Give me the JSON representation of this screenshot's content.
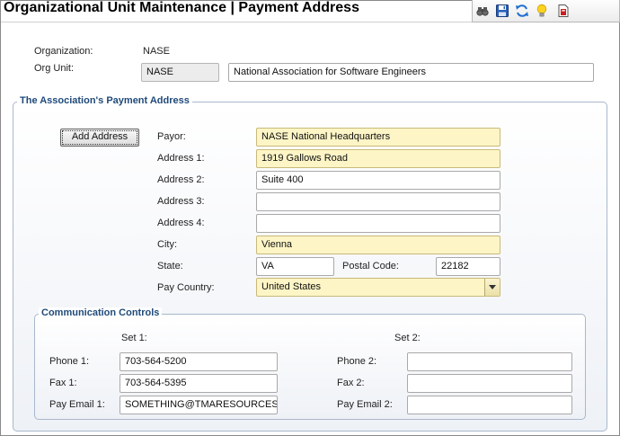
{
  "header": {
    "title": "Organizational Unit Maintenance | Payment Address",
    "toolbar_icons": [
      "binoculars-icon",
      "save-icon",
      "refresh-icon",
      "lightbulb-icon",
      "report-icon"
    ]
  },
  "org": {
    "organization_label": "Organization:",
    "organization_value": "NASE",
    "org_unit_label": "Org Unit:",
    "org_unit_code": "NASE",
    "org_unit_name": "National Association for Software Engineers"
  },
  "payment_address": {
    "legend": "The Association's Payment Address",
    "add_address_label": "Add Address",
    "payor_label": "Payor:",
    "payor_value": "NASE National Headquarters",
    "address1_label": "Address 1:",
    "address1_value": "1919 Gallows Road",
    "address2_label": "Address 2:",
    "address2_value": "Suite 400",
    "address3_label": "Address 3:",
    "address3_value": "",
    "address4_label": "Address 4:",
    "address4_value": "",
    "city_label": "City:",
    "city_value": "Vienna",
    "state_label": "State:",
    "state_value": "VA",
    "postal_label": "Postal Code:",
    "postal_value": "22182",
    "country_label": "Pay Country:",
    "country_value": "United States"
  },
  "communication": {
    "legend": "Communication Controls",
    "set1_label": "Set 1:",
    "set2_label": "Set 2:",
    "phone1_label": "Phone 1:",
    "phone1_value": "703-564-5200",
    "fax1_label": "Fax 1:",
    "fax1_value": "703-564-5395",
    "email1_label": "Pay Email 1:",
    "email1_value": "SOMETHING@TMARESOURCES.C",
    "phone2_label": "Phone 2:",
    "phone2_value": "",
    "fax2_label": "Fax 2:",
    "fax2_value": "",
    "email2_label": "Pay Email 2:",
    "email2_value": ""
  },
  "colors": {
    "required_field": "#fdf5c6",
    "legend_text": "#1f4a7a"
  }
}
